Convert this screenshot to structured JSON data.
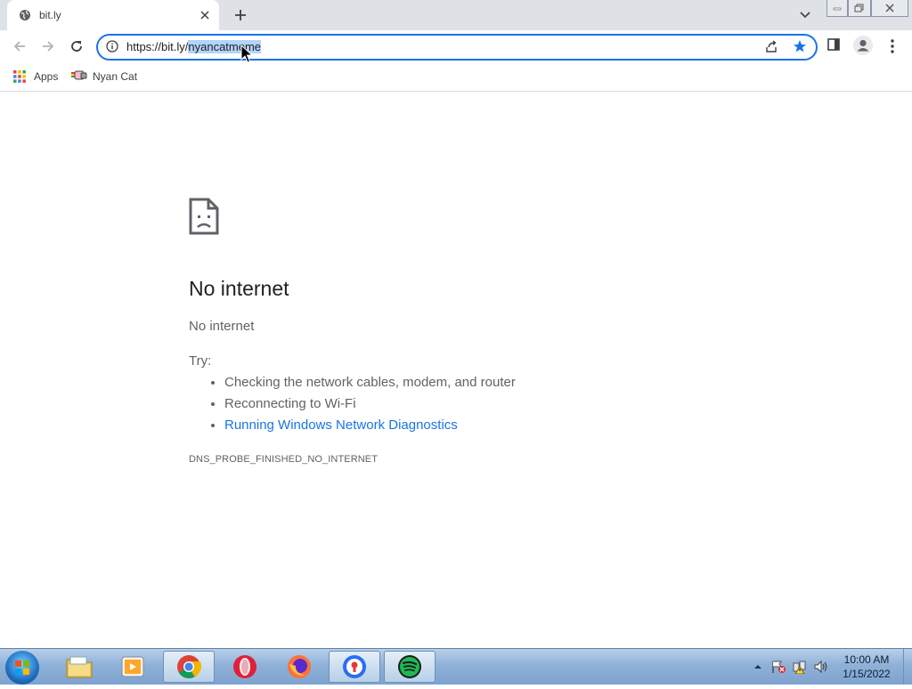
{
  "tab": {
    "title": "bit.ly",
    "favicon": "globe-icon"
  },
  "omnibox": {
    "url_prefix": "https://bit.ly/",
    "url_selected": "nyancatmeme",
    "focus_color": "#1a73e8"
  },
  "bookmarks": [
    {
      "label": "Apps",
      "icon": "apps-grid-icon"
    },
    {
      "label": "Nyan Cat",
      "icon": "nyan-cat-icon"
    }
  ],
  "error_page": {
    "heading": "No internet",
    "subheading": "No internet",
    "try_label": "Try:",
    "suggestions": [
      "Checking the network cables, modem, and router",
      "Reconnecting to Wi-Fi",
      "Running Windows Network Diagnostics"
    ],
    "error_code": "DNS_PROBE_FINISHED_NO_INTERNET",
    "link_color": "#1a73e8"
  },
  "taskbar": {
    "apps": [
      "file-explorer-icon",
      "media-player-icon",
      "chrome-icon",
      "opera-icon",
      "firefox-icon",
      "privacy-browser-icon",
      "spotify-icon"
    ],
    "active_apps": [
      "chrome-icon",
      "privacy-browser-icon",
      "spotify-icon"
    ],
    "clock_time": "10:00 AM",
    "clock_date": "1/15/2022"
  }
}
